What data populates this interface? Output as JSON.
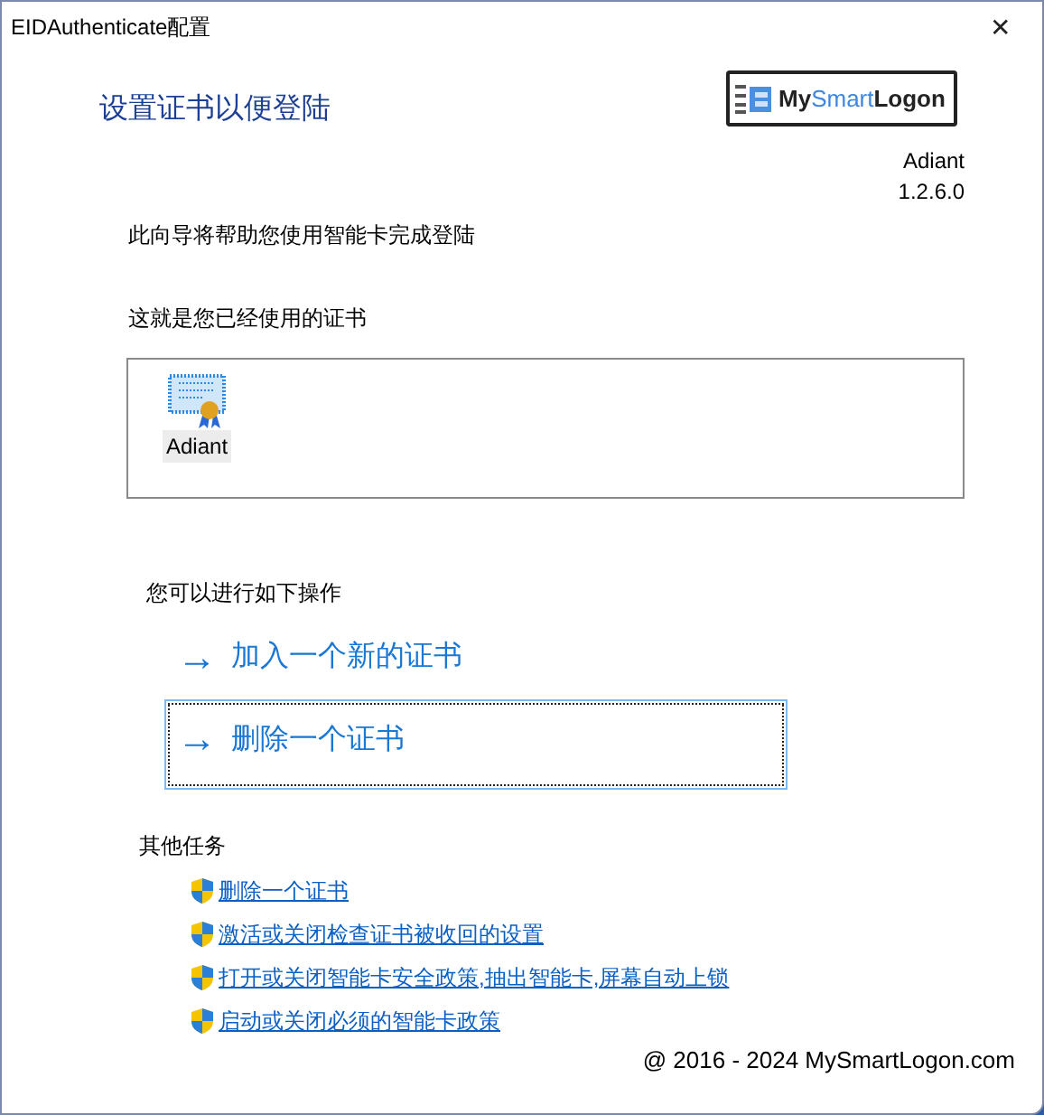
{
  "window": {
    "title": "EIDAuthenticate配置",
    "close": "✕"
  },
  "heading": "设置证书以便登陆",
  "logo": {
    "parts": [
      {
        "text": "My",
        "accent": false
      },
      {
        "text": "Smart",
        "accent": true
      },
      {
        "text": "Logon",
        "accent": false
      }
    ]
  },
  "product": "Adiant",
  "version": "1.2.6.0",
  "intro": "此向导将帮助您使用智能卡完成登陆",
  "certificates_label": "这就是您已经使用的证书",
  "certificates": [
    {
      "name": "Adiant",
      "selected": true
    }
  ],
  "actions_label": "您可以进行如下操作",
  "actions": [
    {
      "arrow": "→",
      "label": "加入一个新的证书",
      "focused": false
    },
    {
      "arrow": "→",
      "label": "删除一个证书",
      "focused": true
    }
  ],
  "other_tasks_label": "其他任务",
  "other_tasks": [
    "删除一个证书",
    "激活或关闭检查证书被收回的设置",
    "打开或关闭智能卡安全政策,抽出智能卡,屏幕自动上锁",
    "启动或关闭必须的智能卡政策"
  ],
  "footer": "@ 2016 - 2024 MySmartLogon.com"
}
